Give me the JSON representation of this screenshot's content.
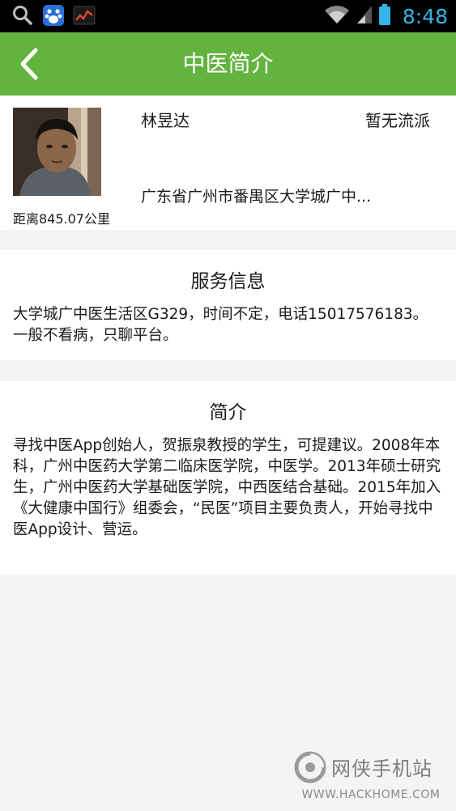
{
  "status_bar": {
    "time": "8:48"
  },
  "header": {
    "title": "中医简介"
  },
  "profile": {
    "name": "林昱达",
    "school": "暂无流派",
    "address": "广东省广州市番禺区大学城广中...",
    "distance": "距离845.07公里"
  },
  "service": {
    "title": "服务信息",
    "body": "大学城广中医生活区G329，时间不定，电话15017576183。一般不看病，只聊平台。"
  },
  "intro": {
    "title": "简介",
    "body": "寻找中医App创始人，贺振泉教授的学生，可提建议。2008年本科，广州中医药大学第二临床医学院，中医学。2013年硕士研究生，广州中医药大学基础医学院，中西医结合基础。2015年加入《大健康中国行》组委会，“民医”项目主要负责人，开始寻找中医App设计、营运。"
  },
  "watermark": {
    "name": "网侠手机站",
    "url": "WWW.HACKHOME.COM"
  },
  "colors": {
    "header_green": "#63b43e",
    "status_blue": "#33b5e5",
    "background": "#f4f4f4"
  }
}
